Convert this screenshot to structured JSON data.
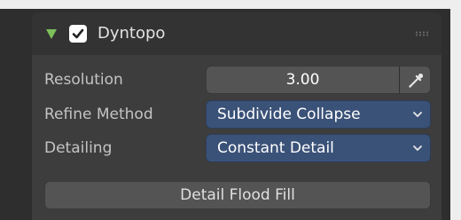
{
  "colors": {
    "accent_green": "#7cc05a",
    "dropdown_blue": "#3b5278",
    "field_gray": "#545454",
    "panel_bg": "#3d3d3d"
  },
  "panel": {
    "title": "Dyntopo",
    "enabled": true,
    "expanded": true,
    "icons": {
      "collapse": "disclosure-triangle-down-icon",
      "checkbox": "checkmark-icon",
      "grip": "drag-grip-icon"
    }
  },
  "properties": {
    "resolution": {
      "label": "Resolution",
      "value": "3.00",
      "icon": "eyedropper-icon"
    },
    "refine_method": {
      "label": "Refine Method",
      "value": "Subdivide Collapse",
      "icon": "chevron-down-icon"
    },
    "detailing": {
      "label": "Detailing",
      "value": "Constant Detail",
      "icon": "chevron-down-icon"
    }
  },
  "actions": {
    "flood_fill_label": "Detail Flood Fill"
  }
}
